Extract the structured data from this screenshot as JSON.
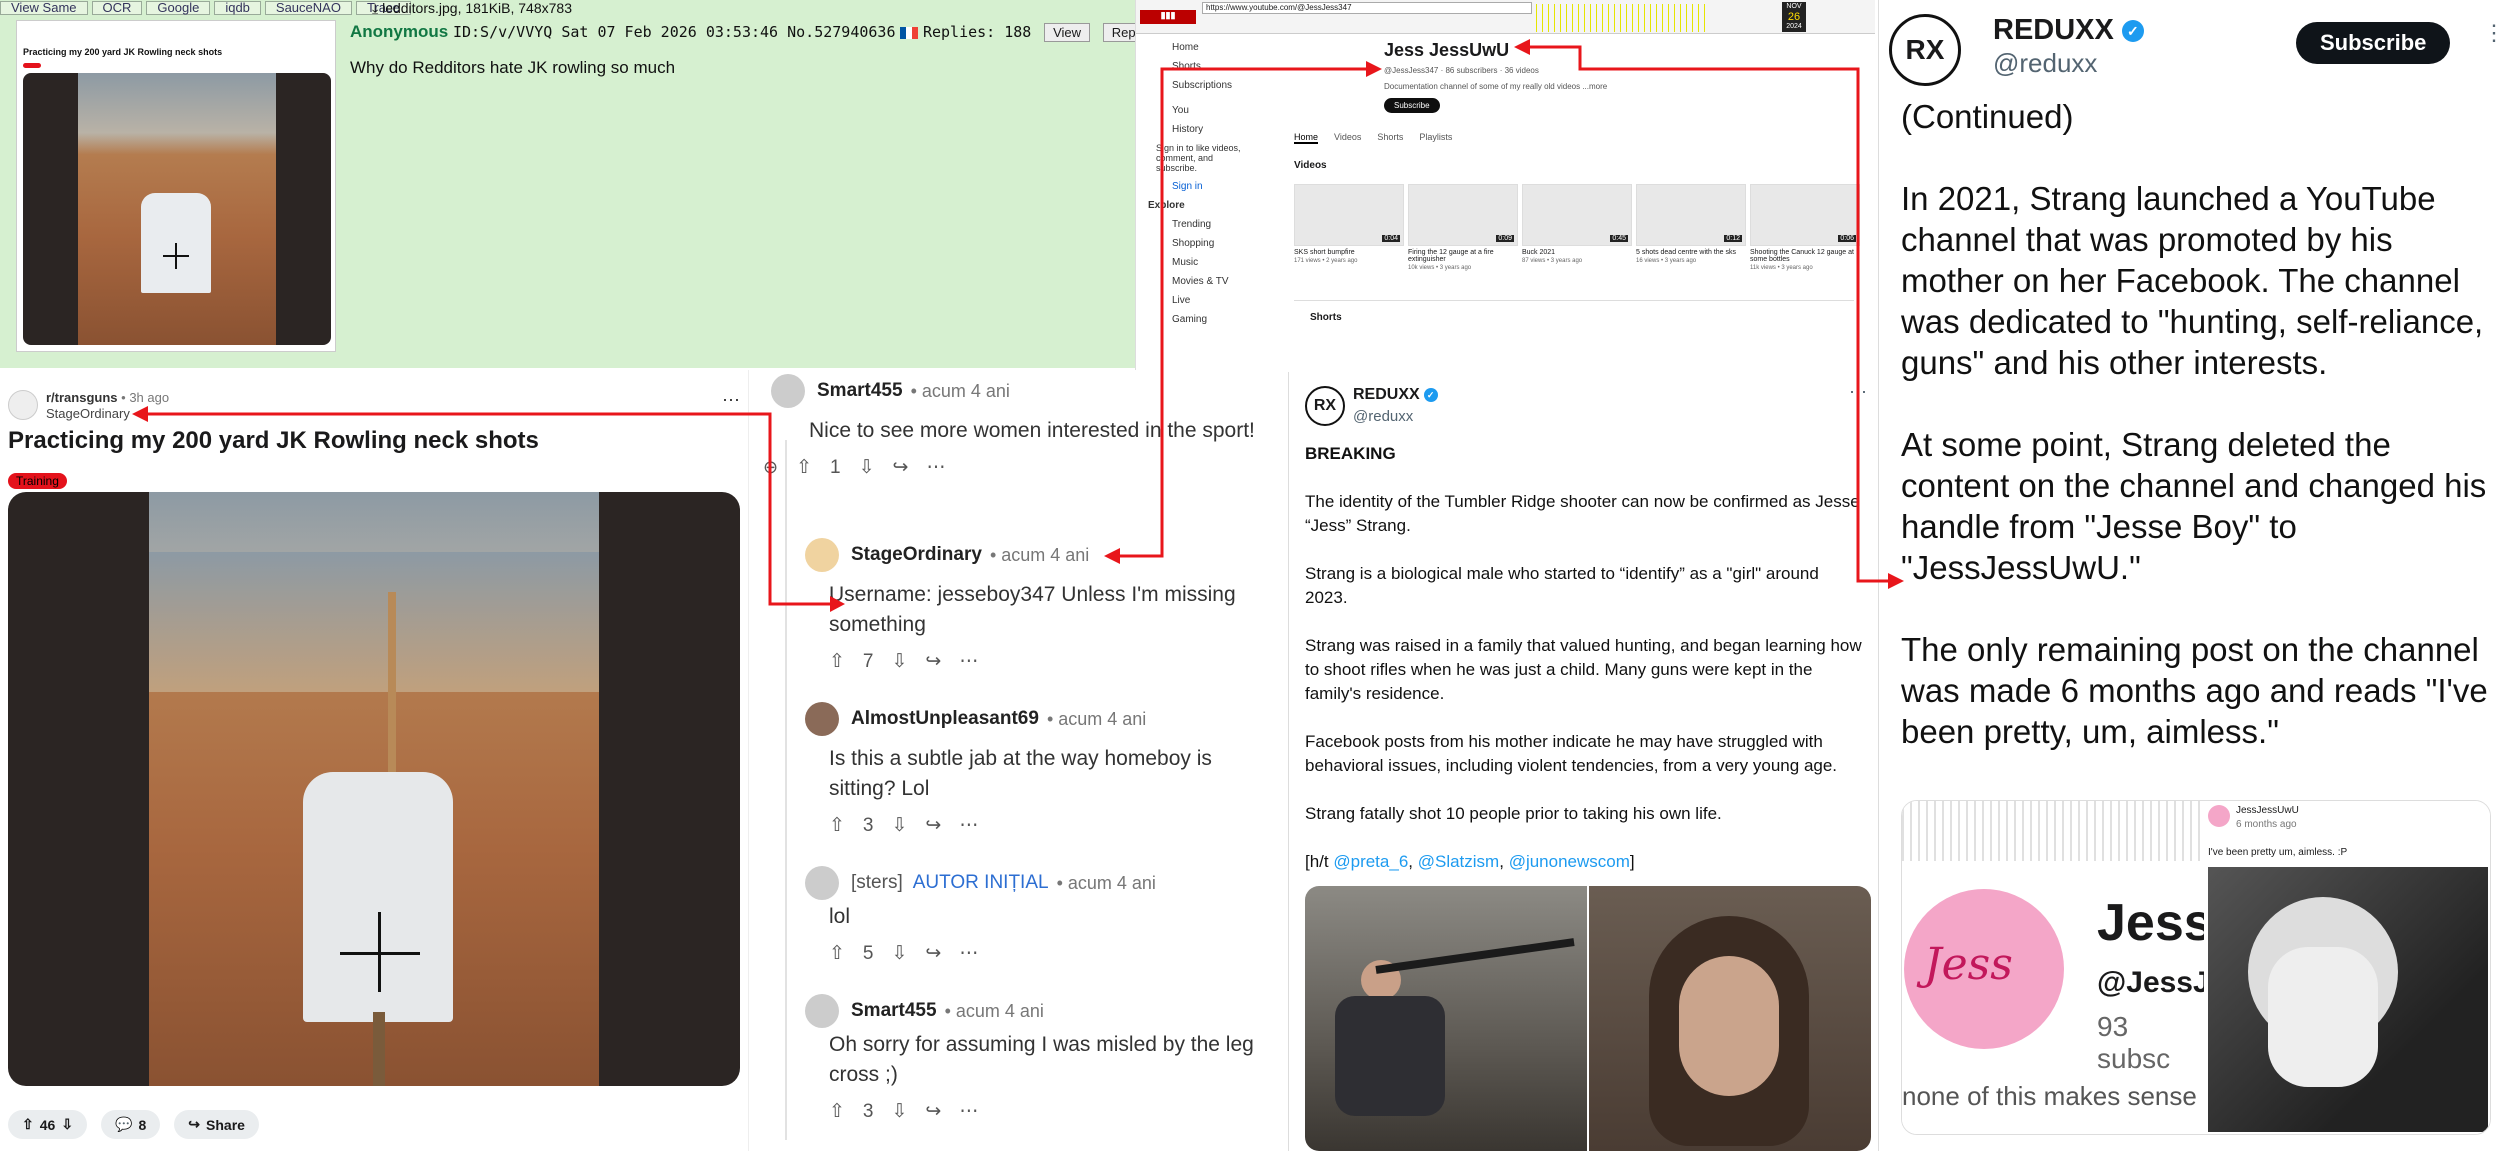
{
  "chan": {
    "toolbar": [
      "View Same",
      "OCR",
      "Google",
      "iqdb",
      "SauceNAO",
      "Trace"
    ],
    "file_info": "ledditors.jpg, 181KiB, 748x783",
    "name": "Anonymous",
    "post_meta": "ID:S/v/VVYQ Sat 07 Feb 2026 03:53:46 No.527940636",
    "replies": "Replies: 188",
    "view_btn": "View",
    "reply_btn": "Rep",
    "message": "Why do Redditors hate JK rowling so much",
    "thumb_title": "Practicing my 200 yard JK Rowling neck shots"
  },
  "reddit_post": {
    "subreddit": "r/transguns",
    "time": "3h ago",
    "author": "StageOrdinary",
    "title": "Practicing my 200 yard JK Rowling neck shots",
    "flair": "Training",
    "upvotes": "46",
    "comments": "8",
    "share": "Share"
  },
  "comments": [
    {
      "user": "Smart455",
      "time": "• acum 4 ani",
      "body": "Nice to see more women interested in the sport!",
      "votes": "1"
    },
    {
      "user": "StageOrdinary",
      "time": "• acum 4 ani",
      "body": "Username: jesseboy347 Unless I'm missing something",
      "votes": "7"
    },
    {
      "user": "AlmostUnpleasant69",
      "time": "• acum 4 ani",
      "body": "Is this a subtle jab at the way homeboy is sitting? Lol",
      "votes": "3"
    },
    {
      "user": "[sters]",
      "badge": "AUTOR INIȚIAL",
      "time": "• acum 4 ani",
      "body": "lol",
      "votes": "5"
    },
    {
      "user": "Smart455",
      "time": "• acum 4 ani",
      "body": "Oh sorry for assuming I was misled by the leg cross ;)",
      "votes": "3"
    }
  ],
  "youtube": {
    "url": "https://www.youtube.com/@JessJess347",
    "date_month": "NOV",
    "date_day": "26",
    "date_year": "2024",
    "channel_name": "Jess JessUwU",
    "handle_line": "@JessJess347 · 86 subscribers · 36 videos",
    "description": "Documentation channel of some of my really old videos ...more",
    "subscribe": "Subscribe",
    "tabs": [
      "Home",
      "Videos",
      "Shorts",
      "Playlists"
    ],
    "videos_heading": "Videos",
    "shorts_heading": "Shorts",
    "sidebar": [
      "Home",
      "Shorts",
      "Subscriptions",
      "You",
      "History",
      "Sign in to like videos, comment, and subscribe.",
      "Sign in",
      "Explore",
      "Trending",
      "Shopping",
      "Music",
      "Movies & TV",
      "Live",
      "Gaming"
    ],
    "videos": [
      {
        "title": "SKS short bumpfire",
        "meta": "171 views • 2 years ago",
        "dur": "0:04"
      },
      {
        "title": "Firing the 12 gauge at a fire extinguisher",
        "meta": "10k views • 3 years ago",
        "dur": "0:09"
      },
      {
        "title": "Buck 2021",
        "meta": "87 views • 3 years ago",
        "dur": "0:45"
      },
      {
        "title": "5 shots dead centre with the sks",
        "meta": "16 views • 3 years ago",
        "dur": "0:12"
      },
      {
        "title": "Shooting the Canuck 12 gauge at some bottles",
        "meta": "11k views • 3 years ago",
        "dur": "0:06"
      }
    ]
  },
  "tweet": {
    "name": "REDUXX",
    "handle": "@reduxx",
    "heading": "BREAKING",
    "paragraphs": [
      "The identity of the Tumbler Ridge shooter can now be confirmed as Jesse “Jess” Strang.",
      "Strang is a biological male who started to “identify” as a \"girl\" around 2023.",
      "Strang was raised in a family that valued hunting, and began learning how to shoot rifles when he was just a child. Many guns were kept in the family's residence.",
      "Facebook posts from his mother indicate he may have struggled with behavioral issues, including violent tendencies, from a very young age.",
      "Strang fatally shot 10 people prior to taking his own life."
    ],
    "ht_prefix": "[h/t ",
    "mentions": [
      "@preta_6",
      "@Slatzism",
      "@junonewscom"
    ],
    "ht_suffix": "]"
  },
  "right": {
    "name": "REDUXX",
    "handle": "@reduxx",
    "subscribe": "Subscribe",
    "paragraphs": [
      "(Continued)",
      "In 2021, Strang launched a YouTube channel that was promoted by his mother on her Facebook. The channel was dedicated to \"hunting, self-reliance, guns\" and his other interests.",
      "At some point, Strang deleted the content on the channel and changed his handle from \"Jesse Boy\" to \"JessJessUwU.\"",
      "The only remaining post on the channel was made 6 months ago and reads \"I've been pretty, um, aimless.\""
    ],
    "card_name": "Jess",
    "card_handle": "@JessJe",
    "card_subs": "93 subsc",
    "card_caption": "none of this makes sense",
    "post_user": "JessJessUwU",
    "post_time": "6 months ago",
    "post_text": "I've been pretty um, aimless. :P"
  },
  "colors": {
    "annotation": "#e8161b",
    "chan_bg": "#d6f0d0",
    "verified": "#1d9bf0",
    "flair": "#e4121b"
  }
}
